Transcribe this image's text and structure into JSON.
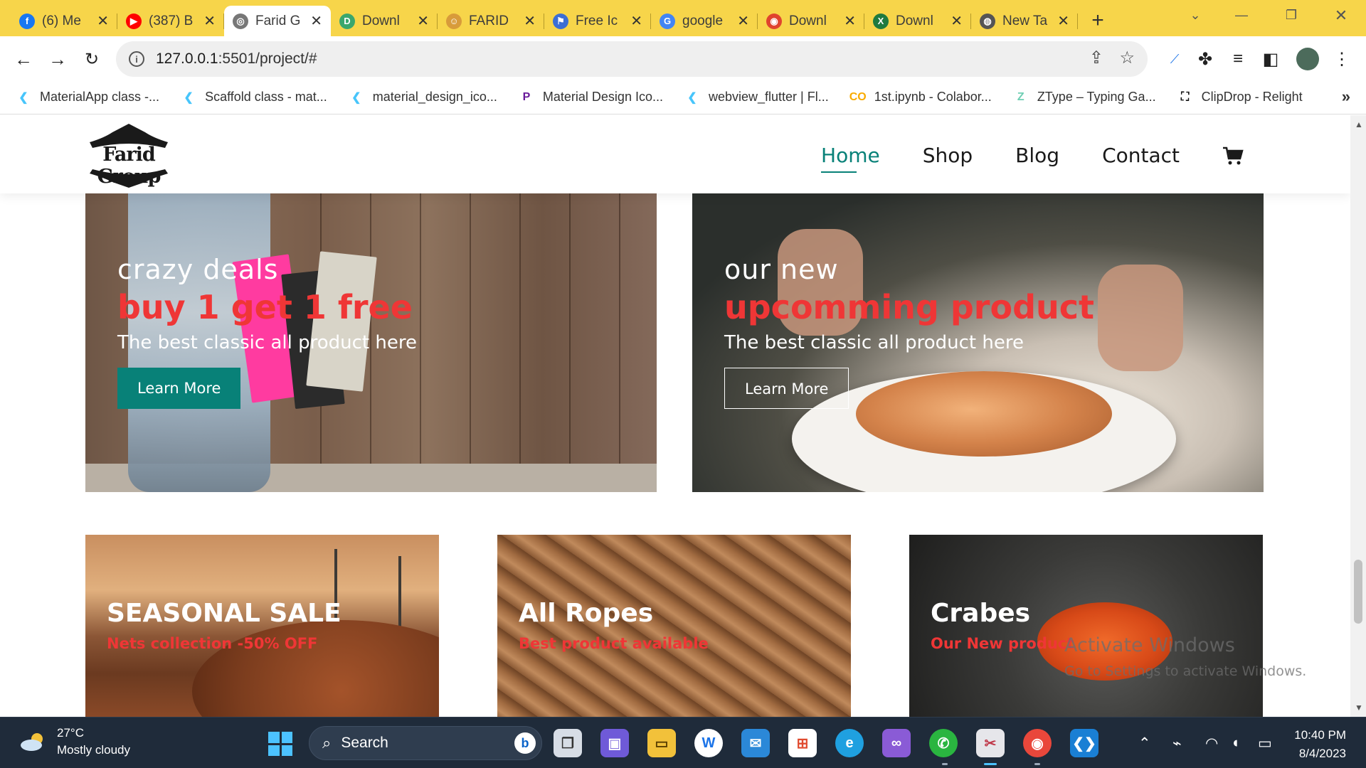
{
  "browser": {
    "tabs": [
      {
        "title": "(6) Me",
        "favicon": "facebook-icon",
        "color": "#1877f2",
        "glyph": "f"
      },
      {
        "title": "(387) B",
        "favicon": "youtube-icon",
        "color": "#ff0000",
        "glyph": "▶"
      },
      {
        "title": "Farid G",
        "favicon": "globe-icon",
        "color": "#777777",
        "glyph": "◎",
        "active": true
      },
      {
        "title": "Downl",
        "favicon": "download-site-icon",
        "color": "#3aa76d",
        "glyph": "D"
      },
      {
        "title": "FARID",
        "favicon": "avatar-icon",
        "color": "#d89b3a",
        "glyph": "☺"
      },
      {
        "title": "Free Ic",
        "favicon": "flag-icon",
        "color": "#3b6ed4",
        "glyph": "⚑"
      },
      {
        "title": "google",
        "favicon": "google-icon",
        "color": "#4285f4",
        "glyph": "G"
      },
      {
        "title": "Downl",
        "favicon": "download-red-icon",
        "color": "#e0442e",
        "glyph": "◉"
      },
      {
        "title": "Downl",
        "favicon": "excel-icon",
        "color": "#1f7a3f",
        "glyph": "X"
      },
      {
        "title": "New Ta",
        "favicon": "chrome-icon",
        "color": "#555555",
        "glyph": "◍"
      }
    ],
    "url_host": "127.0.0.1",
    "url_rest": ":5501/project/#",
    "bookmarks": [
      {
        "label": "MaterialApp class -...",
        "icon": "flutter-icon",
        "color": "#47c5fb",
        "glyph": "❮"
      },
      {
        "label": "Scaffold class - mat...",
        "icon": "flutter-icon",
        "color": "#47c5fb",
        "glyph": "❮"
      },
      {
        "label": "material_design_ico...",
        "icon": "flutter-icon",
        "color": "#47c5fb",
        "glyph": "❮"
      },
      {
        "label": "Material Design Ico...",
        "icon": "material-design-icon",
        "color": "#6a1b9a",
        "glyph": "P"
      },
      {
        "label": "webview_flutter | Fl...",
        "icon": "flutter-icon",
        "color": "#47c5fb",
        "glyph": "❮"
      },
      {
        "label": "1st.ipynb - Colabor...",
        "icon": "colab-icon",
        "color": "#f9ab00",
        "glyph": "CO"
      },
      {
        "label": "ZType – Typing Ga...",
        "icon": "ztype-icon",
        "color": "#6fcfb4",
        "glyph": "Z"
      },
      {
        "label": "ClipDrop - Relight",
        "icon": "clipdrop-icon",
        "color": "#111111",
        "glyph": "⛶"
      }
    ]
  },
  "site": {
    "logo_text": "Farid Group",
    "nav": [
      "Home",
      "Shop",
      "Blog",
      "Contact"
    ],
    "banners": [
      {
        "subtitle": "crazy deals",
        "title": "buy 1 get 1 free",
        "desc": "The best classic all product here",
        "button": "Learn More"
      },
      {
        "subtitle": "our new",
        "title": "upcomming product",
        "desc": "The best classic all product here",
        "button": "Learn More"
      }
    ],
    "small_banners": [
      {
        "title": "SEASONAL SALE",
        "subtitle": "Nets collection -50% OFF"
      },
      {
        "title": "All Ropes",
        "subtitle": "Best product available"
      },
      {
        "title": "Crabes",
        "subtitle": "Our New product"
      }
    ],
    "accent": "#088178",
    "highlight": "#ef3636"
  },
  "watermark": {
    "line1": "Activate Windows",
    "line2": "Go to Settings to activate Windows."
  },
  "taskbar": {
    "temp": "27°C",
    "condition": "Mostly cloudy",
    "search_placeholder": "Search",
    "time": "10:40 PM",
    "date": "8/4/2023"
  }
}
